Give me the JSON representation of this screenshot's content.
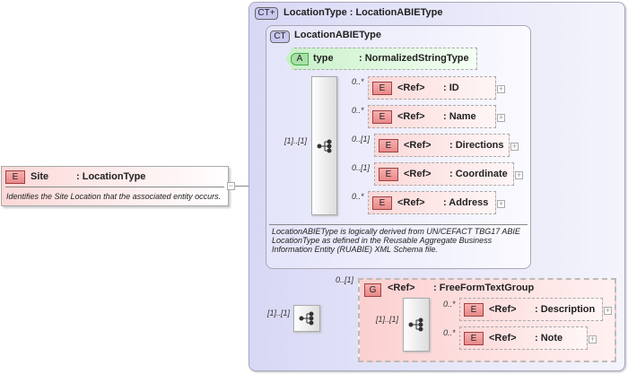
{
  "root": {
    "badge": "E",
    "name": "Site",
    "type": ": LocationType",
    "doc": "Identifies the Site Location that the associated entity occurs.",
    "collapse": "−"
  },
  "complex_type": {
    "badge": "CT+",
    "title": "LocationType : LocationABIEType"
  },
  "base_type": {
    "badge": "CT",
    "title": "LocationABIEType",
    "doc": "LocationABIEType is logically derived from UN/CEFACT TBG17 ABIE LocationType as defined in the Reusable Aggregate Business Information Entity (RUABIE) XML Schema file."
  },
  "attribute": {
    "badge": "A",
    "name": "type",
    "type": ": NormalizedStringType"
  },
  "sequence1": {
    "cardinality": "[1]..[1]"
  },
  "elements": [
    {
      "badge": "E",
      "ref": "<Ref>",
      "name": ": ID",
      "cardinality": "0..*",
      "expand": "+"
    },
    {
      "badge": "E",
      "ref": "<Ref>",
      "name": ": Name",
      "cardinality": "0..*",
      "expand": "+"
    },
    {
      "badge": "E",
      "ref": "<Ref>",
      "name": ": Directions",
      "cardinality": "0..[1]",
      "expand": "+"
    },
    {
      "badge": "E",
      "ref": "<Ref>",
      "name": ": Coordinate",
      "cardinality": "0..[1]",
      "expand": "+"
    },
    {
      "badge": "E",
      "ref": "<Ref>",
      "name": ": Address",
      "cardinality": "0..*",
      "expand": "+"
    }
  ],
  "sequence2": {
    "cardinality": "[1]..[1]"
  },
  "group": {
    "badge": "G",
    "ref": "<Ref>",
    "name": ": FreeFormTextGroup",
    "cardinality": "0..[1]",
    "seq_cardinality": "[1]..[1]",
    "elements": [
      {
        "badge": "E",
        "ref": "<Ref>",
        "name": ": Description",
        "cardinality": "0..*",
        "expand": "+"
      },
      {
        "badge": "E",
        "ref": "<Ref>",
        "name": ": Note",
        "cardinality": "0..*",
        "expand": "+"
      }
    ]
  }
}
